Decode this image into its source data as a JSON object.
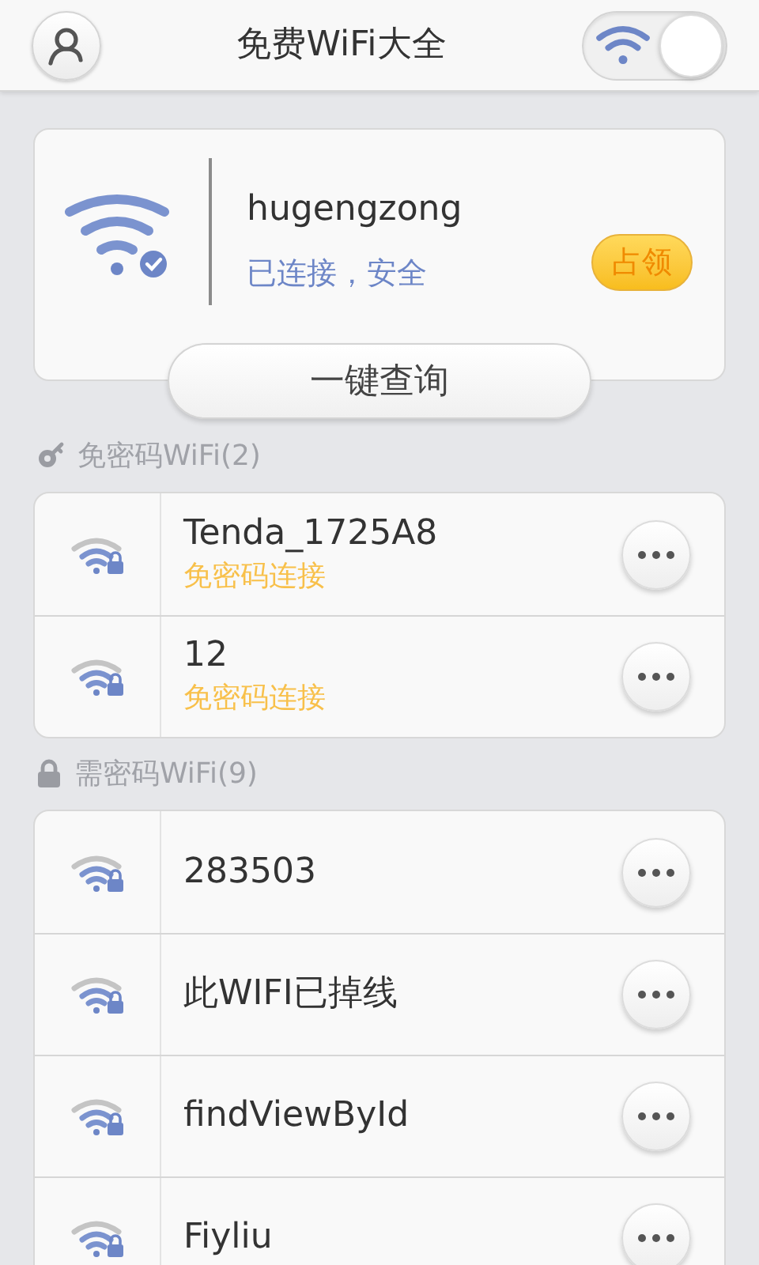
{
  "header": {
    "title": "免费WiFi大全",
    "wifi_switch": {
      "on": true
    }
  },
  "connected": {
    "ssid": "hugengzong",
    "status": "已连接，安全",
    "claim_button": "占领",
    "query_button": "一键查询"
  },
  "sections": [
    {
      "kind": "free",
      "title": "免密码WiFi(2)",
      "networks": [
        {
          "ssid": "Tenda_1725A8",
          "note": "免密码连接"
        },
        {
          "ssid": "12",
          "note": "免密码连接"
        }
      ]
    },
    {
      "kind": "locked",
      "title": "需密码WiFi(9)",
      "networks": [
        {
          "ssid": "283503"
        },
        {
          "ssid": "此WIFI已掉线"
        },
        {
          "ssid": "findViewById"
        },
        {
          "ssid": "Fiyliu"
        }
      ]
    }
  ]
}
